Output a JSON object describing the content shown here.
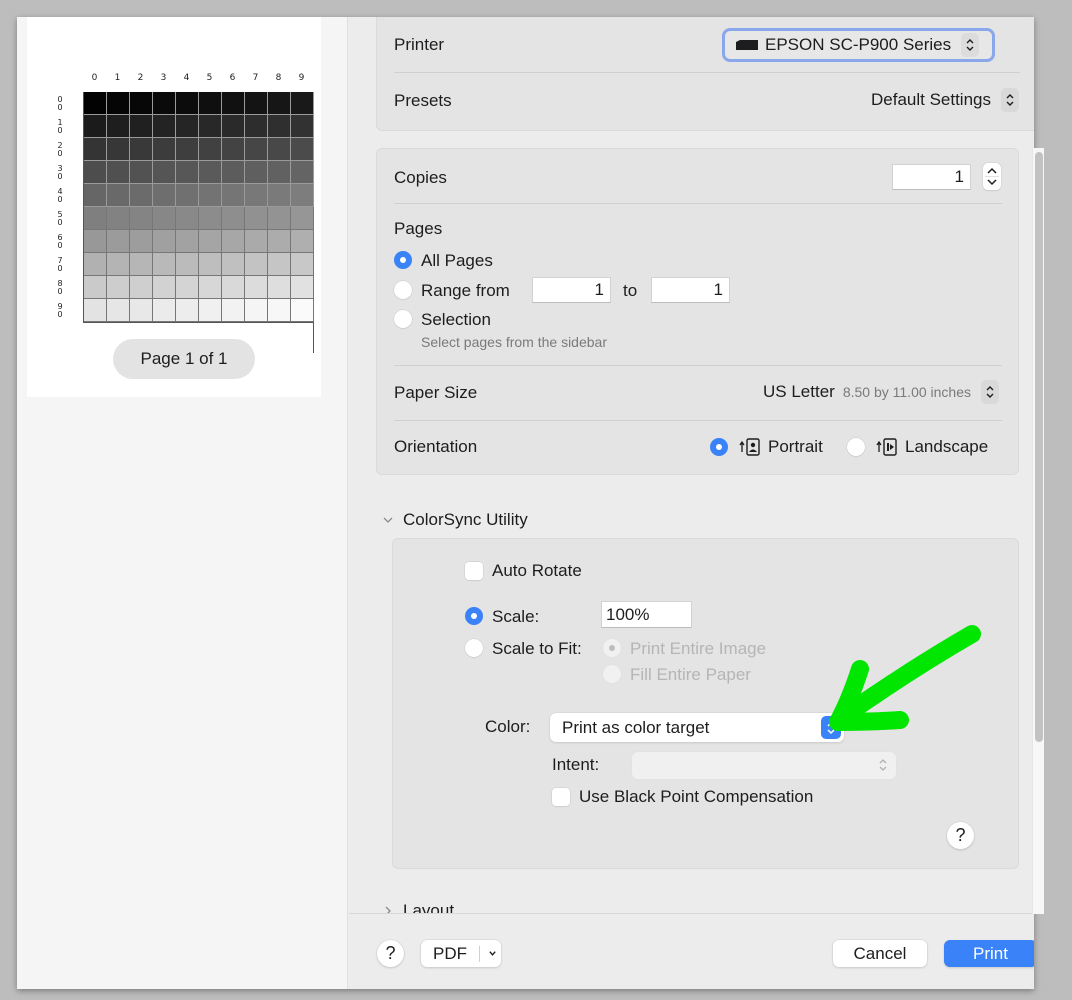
{
  "preview": {
    "column_labels": [
      "0",
      "1",
      "2",
      "3",
      "4",
      "5",
      "6",
      "7",
      "8",
      "9"
    ],
    "row_labels": [
      [
        "0",
        "0"
      ],
      [
        "1",
        "0"
      ],
      [
        "2",
        "0"
      ],
      [
        "3",
        "0"
      ],
      [
        "4",
        "0"
      ],
      [
        "5",
        "0"
      ],
      [
        "6",
        "0"
      ],
      [
        "7",
        "0"
      ],
      [
        "8",
        "0"
      ],
      [
        "9",
        "0"
      ]
    ],
    "page_indicator": "Page 1 of 1",
    "description": "10x10 grayscale step target, black to white"
  },
  "printer_group": {
    "printer_label": "Printer",
    "printer_value": "EPSON SC-P900 Series",
    "presets_label": "Presets",
    "presets_value": "Default Settings"
  },
  "copies_pages_group": {
    "copies_label": "Copies",
    "copies_value": "1",
    "pages_label": "Pages",
    "all_pages_label": "All Pages",
    "range_from_label": "Range from",
    "range_from_value": "1",
    "range_to_label": "to",
    "range_to_value": "1",
    "selection_label": "Selection",
    "selection_hint": "Select pages from the sidebar",
    "selected_option": "All Pages",
    "paper_size_label": "Paper Size",
    "paper_size_value": "US Letter",
    "paper_size_detail": "8.50 by 11.00 inches",
    "orientation_label": "Orientation",
    "portrait_label": "Portrait",
    "landscape_label": "Landscape",
    "selected_orientation": "Portrait"
  },
  "colorsync": {
    "section_title": "ColorSync Utility",
    "auto_rotate_label": "Auto Rotate",
    "auto_rotate_checked": false,
    "scale_label": "Scale:",
    "scale_value": "100%",
    "scale_to_fit_label": "Scale to Fit:",
    "print_entire_image_label": "Print Entire Image",
    "fill_entire_paper_label": "Fill Entire Paper",
    "selected_scale_mode": "Scale",
    "color_label": "Color:",
    "color_value": "Print as color target",
    "intent_label": "Intent:",
    "intent_value": "",
    "black_point_label": "Use Black Point Compensation",
    "black_point_checked": false,
    "help_label": "?"
  },
  "collapsed_sections": [
    {
      "title": "Layout"
    }
  ],
  "footer": {
    "help_label": "?",
    "pdf_label": "PDF",
    "cancel_label": "Cancel",
    "print_label": "Print"
  },
  "colors": {
    "accent": "#3a82f7",
    "focus_ring": "#8aa7ec",
    "annotation_green": "#00e600"
  }
}
